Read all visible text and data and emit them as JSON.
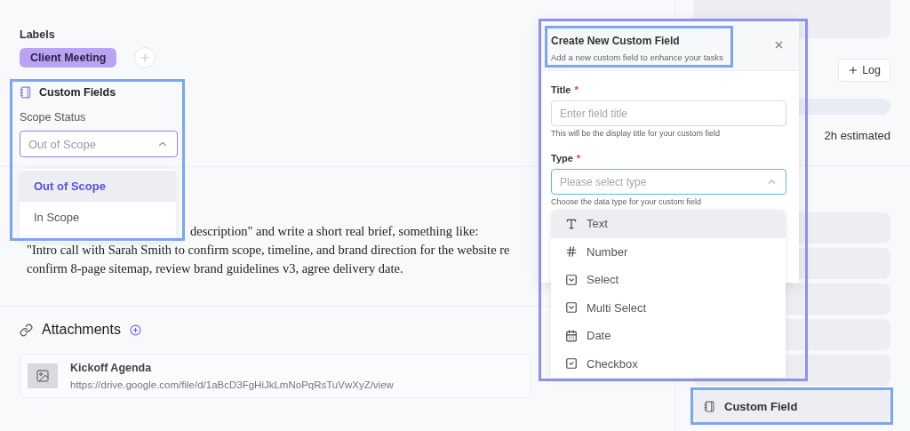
{
  "labels": {
    "title": "Labels",
    "items": [
      {
        "text": "Client Meeting",
        "color": "#b9a4f4"
      }
    ]
  },
  "custom_fields": {
    "title": "Custom Fields",
    "highlighted": true,
    "field_label": "Scope Status",
    "select": {
      "value": "Out of Scope",
      "expanded": true
    },
    "options": [
      {
        "label": "Out of Scope",
        "selected": true
      },
      {
        "label": "In Scope",
        "selected": false
      }
    ]
  },
  "description": {
    "lines": [
      "description\" and write a short real brief, something like:",
      "\"Intro call with Sarah Smith to confirm scope, timeline, and brand direction for the website re",
      "confirm 8-page sitemap, review brand guidelines v3, agree delivery date."
    ]
  },
  "attachments": {
    "title": "Attachments",
    "items": [
      {
        "name": "Kickoff Agenda",
        "url": "https://drive.google.com/file/d/1aBcD3FgHiJkLmNoPqRsTuVwXyZ/view"
      }
    ]
  },
  "sidebar": {
    "log_button": "Log",
    "estimate": "2h estimated",
    "items": [
      {
        "highlighted": false
      },
      {
        "highlighted": false
      },
      {
        "highlighted": false
      },
      {
        "highlighted": false
      },
      {
        "highlighted": false
      },
      {
        "label": "Custom Field",
        "highlighted": true
      }
    ]
  },
  "modal": {
    "title": "Create New Custom Field",
    "subtitle": "Add a new custom field to enhance your tasks",
    "highlighted": true,
    "header_highlighted": true,
    "title_field": {
      "label": "Title",
      "required_mark": "*",
      "placeholder": "Enter field title",
      "hint": "This will be the display title for your custom field"
    },
    "type_field": {
      "label": "Type",
      "required_mark": "*",
      "placeholder": "Please select type",
      "hint": "Choose the data type for your custom field",
      "expanded": true
    },
    "type_options": [
      {
        "label": "Text",
        "kind": "text",
        "selected": true
      },
      {
        "label": "Number",
        "kind": "number",
        "selected": false
      },
      {
        "label": "Select",
        "kind": "select",
        "selected": false
      },
      {
        "label": "Multi Select",
        "kind": "multi_select",
        "selected": false
      },
      {
        "label": "Date",
        "kind": "date",
        "selected": false
      },
      {
        "label": "Checkbox",
        "kind": "checkbox",
        "selected": false
      }
    ]
  }
}
